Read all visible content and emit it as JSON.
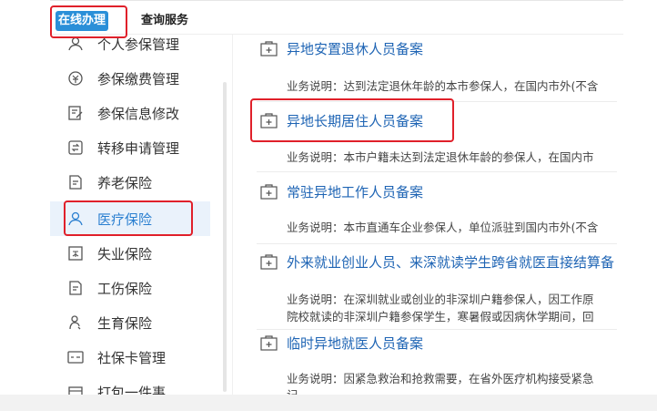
{
  "tabs": [
    {
      "label": "在线办理",
      "active": true
    },
    {
      "label": "查询服务",
      "active": false
    }
  ],
  "sidebar": {
    "items": [
      {
        "label": "个人参保管理",
        "icon": "person-icon"
      },
      {
        "label": "参保缴费管理",
        "icon": "coin-icon"
      },
      {
        "label": "参保信息修改",
        "icon": "edit-icon"
      },
      {
        "label": "转移申请管理",
        "icon": "transfer-icon"
      },
      {
        "label": "养老保险",
        "icon": "document-icon"
      },
      {
        "label": "医疗保险",
        "icon": "person-icon"
      },
      {
        "label": "失业保险",
        "icon": "badge-icon"
      },
      {
        "label": "工伤保险",
        "icon": "document-icon"
      },
      {
        "label": "生育保险",
        "icon": "baby-icon"
      },
      {
        "label": "社保卡管理",
        "icon": "card-icon"
      },
      {
        "label": "打包一件事",
        "icon": "package-icon"
      }
    ],
    "selected": "医疗保险"
  },
  "main": {
    "entries": [
      {
        "title": "异地安置退休人员备案",
        "desc": [
          "业务说明：达到法定退休年龄的本市参保人，在国内市外(不含"
        ]
      },
      {
        "title": "异地长期居住人员备案",
        "desc": [
          "业务说明：本市户籍未达到法定退休年龄的参保人，在国内市"
        ]
      },
      {
        "title": "常驻异地工作人员备案",
        "desc": [
          "业务说明：本市直通车企业参保人，单位派驻到国内市外(不含"
        ]
      },
      {
        "title": "外来就业创业人员、来深就读学生跨省就医直接结算备",
        "desc": [
          "业务说明：在深圳就业或创业的非深圳户籍参保人，因工作原",
          "院校就读的非深圳户籍参保学生，寒暑假或因病休学期间，回"
        ]
      },
      {
        "title": "临时异地就医人员备案",
        "desc": [
          "业务说明：因紧急救治和抢救需要，在省外医疗机构接受紧急",
          "记"
        ]
      }
    ]
  },
  "colors": {
    "accent": "#2a8fd8",
    "link": "#1e64b4",
    "highlight": "#e0202a"
  }
}
